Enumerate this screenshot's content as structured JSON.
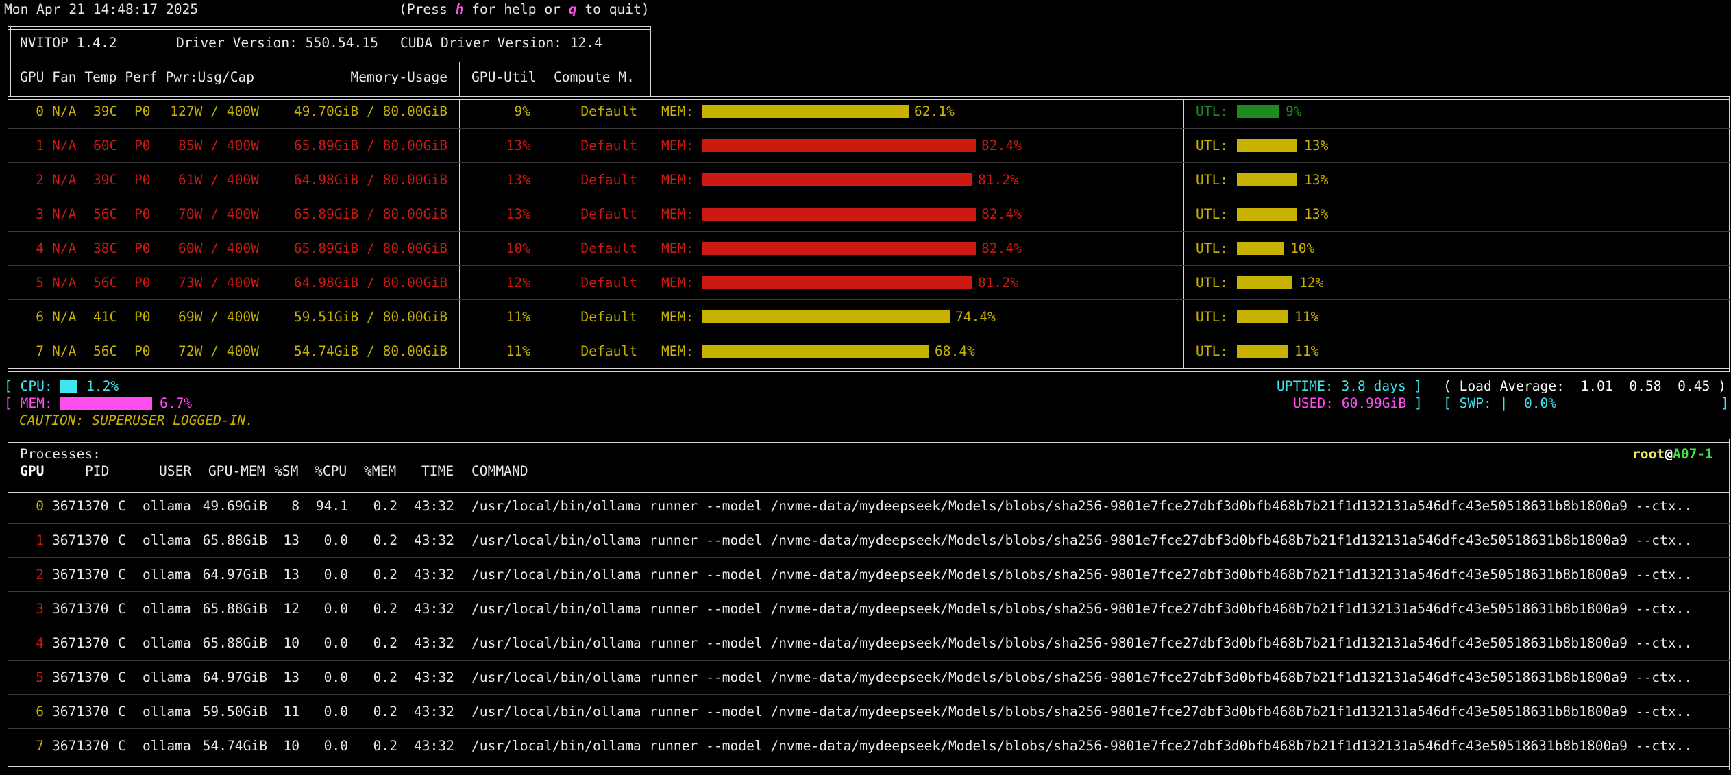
{
  "header": {
    "datetime": "Mon Apr 21 14:48:17 2025",
    "help_prefix": "(Press ",
    "help_key_h": "h",
    "help_middle": " for help or ",
    "help_key_q": "q",
    "help_suffix": " to quit)"
  },
  "info": {
    "nvitop": "NVITOP 1.4.2",
    "driver": "Driver Version: 550.54.15",
    "cuda": "CUDA Driver Version: 12.4"
  },
  "gpu_headers": {
    "left": "GPU Fan Temp Perf Pwr:Usg/Cap",
    "mem": "Memory-Usage",
    "util": "GPU-Util",
    "compute": "Compute M."
  },
  "colors": {
    "yellow": "#c8b200",
    "red": "#cc1a12",
    "green": "#1f8a1f",
    "cyan": "#3fe6ef",
    "magenta": "#ff4df0",
    "white": "#e8e8e8"
  },
  "gpus": [
    {
      "idx": "0",
      "fan": "N/A",
      "temp": "39C",
      "perf": "P0",
      "pwr": "127W / 400W",
      "mem_usage": "49.70GiB / 80.00GiB",
      "util": "9%",
      "compute": "Default",
      "mem_label": "MEM:",
      "mem_pct": "62.1%",
      "mem_frac": 0.621,
      "util_label": "UTL:",
      "util_pct": "9%",
      "util_frac": 0.09,
      "color": "yellow",
      "util_color": "green"
    },
    {
      "idx": "1",
      "fan": "N/A",
      "temp": "60C",
      "perf": "P0",
      "pwr": "85W / 400W",
      "mem_usage": "65.89GiB / 80.00GiB",
      "util": "13%",
      "compute": "Default",
      "mem_label": "MEM:",
      "mem_pct": "82.4%",
      "mem_frac": 0.824,
      "util_label": "UTL:",
      "util_pct": "13%",
      "util_frac": 0.13,
      "color": "red",
      "util_color": "yellow"
    },
    {
      "idx": "2",
      "fan": "N/A",
      "temp": "39C",
      "perf": "P0",
      "pwr": "61W / 400W",
      "mem_usage": "64.98GiB / 80.00GiB",
      "util": "13%",
      "compute": "Default",
      "mem_label": "MEM:",
      "mem_pct": "81.2%",
      "mem_frac": 0.812,
      "util_label": "UTL:",
      "util_pct": "13%",
      "util_frac": 0.13,
      "color": "red",
      "util_color": "yellow"
    },
    {
      "idx": "3",
      "fan": "N/A",
      "temp": "56C",
      "perf": "P0",
      "pwr": "70W / 400W",
      "mem_usage": "65.89GiB / 80.00GiB",
      "util": "13%",
      "compute": "Default",
      "mem_label": "MEM:",
      "mem_pct": "82.4%",
      "mem_frac": 0.824,
      "util_label": "UTL:",
      "util_pct": "13%",
      "util_frac": 0.13,
      "color": "red",
      "util_color": "yellow"
    },
    {
      "idx": "4",
      "fan": "N/A",
      "temp": "38C",
      "perf": "P0",
      "pwr": "60W / 400W",
      "mem_usage": "65.89GiB / 80.00GiB",
      "util": "10%",
      "compute": "Default",
      "mem_label": "MEM:",
      "mem_pct": "82.4%",
      "mem_frac": 0.824,
      "util_label": "UTL:",
      "util_pct": "10%",
      "util_frac": 0.1,
      "color": "red",
      "util_color": "yellow"
    },
    {
      "idx": "5",
      "fan": "N/A",
      "temp": "56C",
      "perf": "P0",
      "pwr": "73W / 400W",
      "mem_usage": "64.98GiB / 80.00GiB",
      "util": "12%",
      "compute": "Default",
      "mem_label": "MEM:",
      "mem_pct": "81.2%",
      "mem_frac": 0.812,
      "util_label": "UTL:",
      "util_pct": "12%",
      "util_frac": 0.12,
      "color": "red",
      "util_color": "yellow"
    },
    {
      "idx": "6",
      "fan": "N/A",
      "temp": "41C",
      "perf": "P0",
      "pwr": "69W / 400W",
      "mem_usage": "59.51GiB / 80.00GiB",
      "util": "11%",
      "compute": "Default",
      "mem_label": "MEM:",
      "mem_pct": "74.4%",
      "mem_frac": 0.744,
      "util_label": "UTL:",
      "util_pct": "11%",
      "util_frac": 0.11,
      "color": "yellow",
      "util_color": "yellow"
    },
    {
      "idx": "7",
      "fan": "N/A",
      "temp": "56C",
      "perf": "P0",
      "pwr": "72W / 400W",
      "mem_usage": "54.74GiB / 80.00GiB",
      "util": "11%",
      "compute": "Default",
      "mem_label": "MEM:",
      "mem_pct": "68.4%",
      "mem_frac": 0.684,
      "util_label": "UTL:",
      "util_pct": "11%",
      "util_frac": 0.11,
      "color": "yellow",
      "util_color": "yellow"
    }
  ],
  "host": {
    "cpu_open": "[ ",
    "cpu_label": "CPU:",
    "cpu_pct": "1.2%",
    "cpu_frac": 0.012,
    "mem_open": "[ ",
    "mem_label": "MEM:",
    "mem_pct": "6.7%",
    "mem_frac": 0.067,
    "caution": "CAUTION: SUPERUSER LOGGED-IN.",
    "uptime": "UPTIME: 3.8 days",
    "uptime_close": " ]",
    "load": "( Load Average:  1.01  0.58  0.45 )",
    "used": "USED: 60.99GiB",
    "used_close": " ]",
    "swp": "[ SWP: ",
    "swp_bar": "|",
    "swp_pct": "  0.0%",
    "swp_close": "]"
  },
  "processes": {
    "title": "Processes:",
    "user": "root",
    "at": "@",
    "host": "A07-1",
    "headers": {
      "gpu": "GPU",
      "pid": "PID",
      "user": "USER",
      "gpu_mem": "GPU-MEM",
      "sm": "%SM",
      "cpu": "%CPU",
      "mem": "%MEM",
      "time": "TIME",
      "command": "COMMAND"
    },
    "rows": [
      {
        "gpu": "0",
        "pid": "3671370",
        "type": "C",
        "user": "ollama",
        "gpu_mem": "49.69GiB",
        "sm": "8",
        "cpu": "94.1",
        "mem": "0.2",
        "time": "43:32",
        "command": "/usr/local/bin/ollama runner --model /nvme-data/mydeepseek/Models/blobs/sha256-9801e7fce27dbf3d0bfb468b7b21f1d132131a546dfc43e50518631b8b1800a9 --ctx..",
        "color": "yellow"
      },
      {
        "gpu": "1",
        "pid": "3671370",
        "type": "C",
        "user": "ollama",
        "gpu_mem": "65.88GiB",
        "sm": "13",
        "cpu": "0.0",
        "mem": "0.2",
        "time": "43:32",
        "command": "/usr/local/bin/ollama runner --model /nvme-data/mydeepseek/Models/blobs/sha256-9801e7fce27dbf3d0bfb468b7b21f1d132131a546dfc43e50518631b8b1800a9 --ctx..",
        "color": "red"
      },
      {
        "gpu": "2",
        "pid": "3671370",
        "type": "C",
        "user": "ollama",
        "gpu_mem": "64.97GiB",
        "sm": "13",
        "cpu": "0.0",
        "mem": "0.2",
        "time": "43:32",
        "command": "/usr/local/bin/ollama runner --model /nvme-data/mydeepseek/Models/blobs/sha256-9801e7fce27dbf3d0bfb468b7b21f1d132131a546dfc43e50518631b8b1800a9 --ctx..",
        "color": "red"
      },
      {
        "gpu": "3",
        "pid": "3671370",
        "type": "C",
        "user": "ollama",
        "gpu_mem": "65.88GiB",
        "sm": "12",
        "cpu": "0.0",
        "mem": "0.2",
        "time": "43:32",
        "command": "/usr/local/bin/ollama runner --model /nvme-data/mydeepseek/Models/blobs/sha256-9801e7fce27dbf3d0bfb468b7b21f1d132131a546dfc43e50518631b8b1800a9 --ctx..",
        "color": "red"
      },
      {
        "gpu": "4",
        "pid": "3671370",
        "type": "C",
        "user": "ollama",
        "gpu_mem": "65.88GiB",
        "sm": "10",
        "cpu": "0.0",
        "mem": "0.2",
        "time": "43:32",
        "command": "/usr/local/bin/ollama runner --model /nvme-data/mydeepseek/Models/blobs/sha256-9801e7fce27dbf3d0bfb468b7b21f1d132131a546dfc43e50518631b8b1800a9 --ctx..",
        "color": "red"
      },
      {
        "gpu": "5",
        "pid": "3671370",
        "type": "C",
        "user": "ollama",
        "gpu_mem": "64.97GiB",
        "sm": "13",
        "cpu": "0.0",
        "mem": "0.2",
        "time": "43:32",
        "command": "/usr/local/bin/ollama runner --model /nvme-data/mydeepseek/Models/blobs/sha256-9801e7fce27dbf3d0bfb468b7b21f1d132131a546dfc43e50518631b8b1800a9 --ctx..",
        "color": "red"
      },
      {
        "gpu": "6",
        "pid": "3671370",
        "type": "C",
        "user": "ollama",
        "gpu_mem": "59.50GiB",
        "sm": "11",
        "cpu": "0.0",
        "mem": "0.2",
        "time": "43:32",
        "command": "/usr/local/bin/ollama runner --model /nvme-data/mydeepseek/Models/blobs/sha256-9801e7fce27dbf3d0bfb468b7b21f1d132131a546dfc43e50518631b8b1800a9 --ctx..",
        "color": "yellow"
      },
      {
        "gpu": "7",
        "pid": "3671370",
        "type": "C",
        "user": "ollama",
        "gpu_mem": "54.74GiB",
        "sm": "10",
        "cpu": "0.0",
        "mem": "0.2",
        "time": "43:32",
        "command": "/usr/local/bin/ollama runner --model /nvme-data/mydeepseek/Models/blobs/sha256-9801e7fce27dbf3d0bfb468b7b21f1d132131a546dfc43e50518631b8b1800a9 --ctx..",
        "color": "yellow"
      }
    ]
  }
}
